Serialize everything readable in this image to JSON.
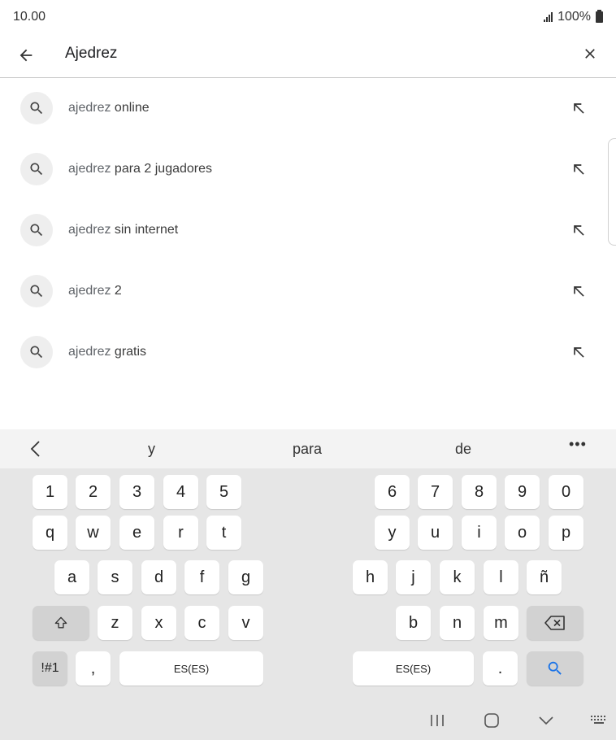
{
  "status_bar": {
    "time": "10.00",
    "battery": "100%",
    "signal_icon": "signal-icon",
    "battery_icon": "battery-icon"
  },
  "search": {
    "query": "Ajedrez",
    "back_icon": "arrow-left-icon",
    "clear_icon": "close-icon"
  },
  "suggestions": [
    {
      "prefix": "ajedrez",
      "suffix": " online"
    },
    {
      "prefix": "ajedrez",
      "suffix": " para 2 jugadores"
    },
    {
      "prefix": "ajedrez",
      "suffix": " sin internet"
    },
    {
      "prefix": "ajedrez",
      "suffix": " 2"
    },
    {
      "prefix": "ajedrez",
      "suffix": " gratis"
    }
  ],
  "keyboard": {
    "predictions": [
      "y",
      "para",
      "de"
    ],
    "more_label": "•••",
    "number_row": [
      "1",
      "2",
      "3",
      "4",
      "5",
      "6",
      "7",
      "8",
      "9",
      "0"
    ],
    "row_q": [
      "q",
      "w",
      "e",
      "r",
      "t",
      "y",
      "u",
      "i",
      "o",
      "p"
    ],
    "row_a": [
      "a",
      "s",
      "d",
      "f",
      "g",
      "h",
      "j",
      "k",
      "l",
      "ñ"
    ],
    "row_z": [
      "z",
      "x",
      "c",
      "v",
      "b",
      "n",
      "m"
    ],
    "symbols_label": "!#1",
    "comma_label": ",",
    "space_left_label": "ES(ES)",
    "space_right_label": "ES(ES)",
    "period_label": "."
  },
  "nav_bar": {
    "recents_icon": "recents-icon",
    "home_icon": "home-icon",
    "back_icon": "chevron-down-icon",
    "keyboard_icon": "keyboard-icon"
  },
  "colors": {
    "accent": "#1a73e8",
    "keyboard_bg": "#e6e6e6",
    "key_bg": "#ffffff"
  }
}
